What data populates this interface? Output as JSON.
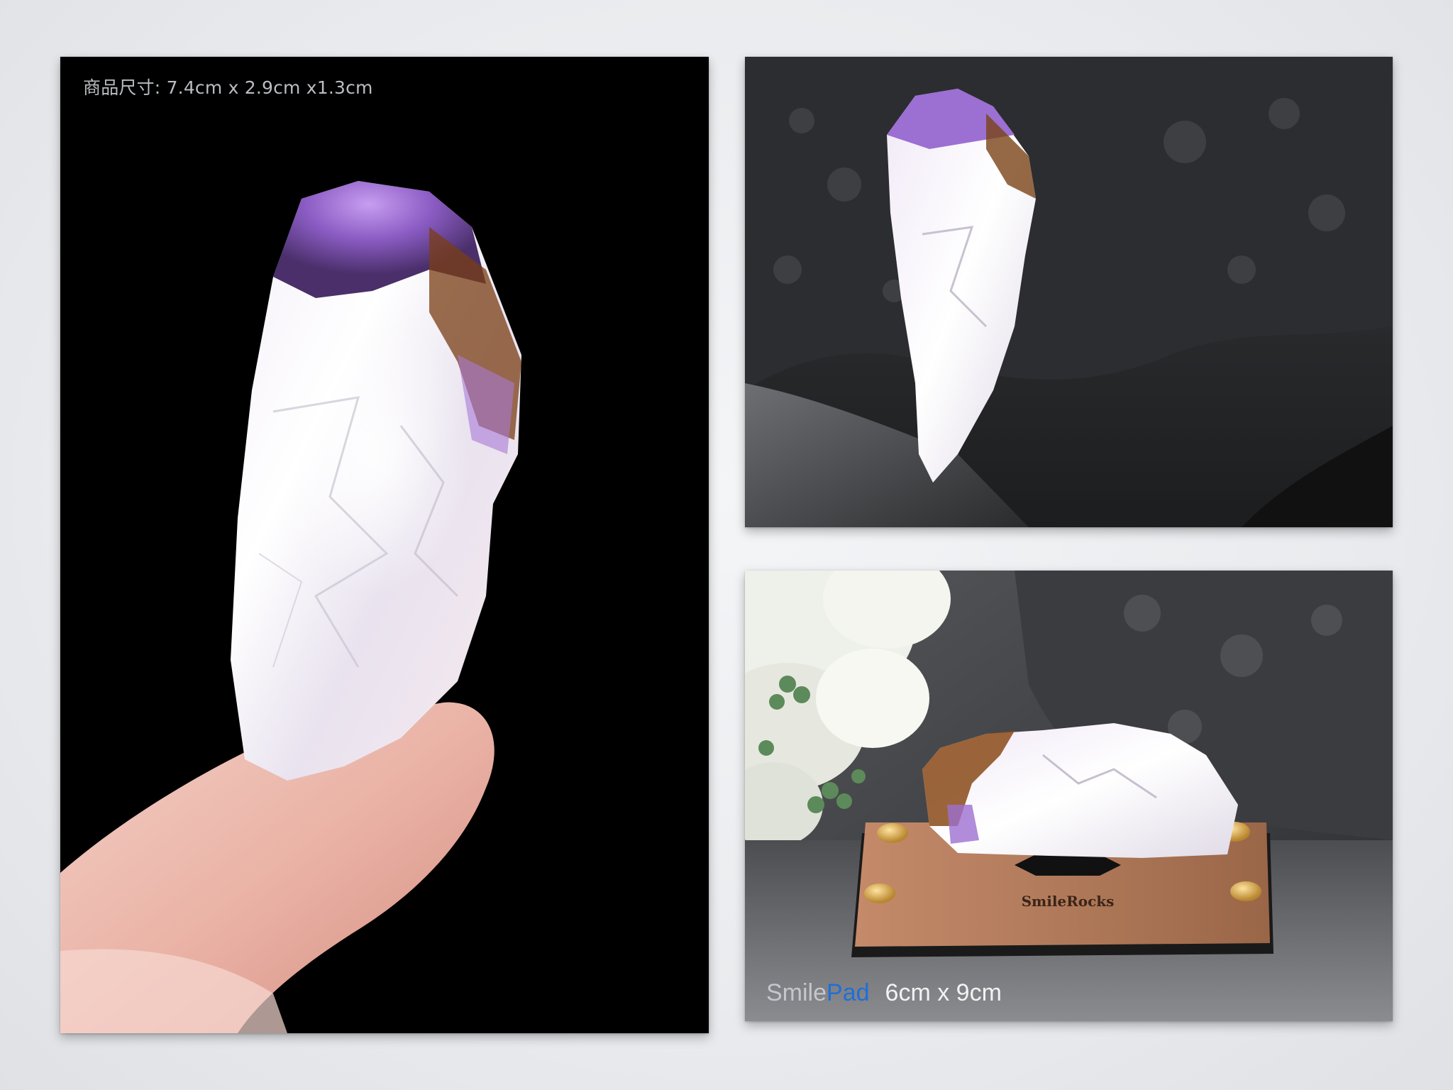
{
  "left_photo": {
    "caption": "商品尺寸: 7.4cm x 2.9cm x1.3cm"
  },
  "bottom_photo": {
    "brand_smile": "Smile",
    "brand_pad": "Pad",
    "dimensions": "6cm x 9cm",
    "engraving": "SmileRocks"
  },
  "colors": {
    "page_background": "#ececef",
    "pad_accent": "#1f6fd6",
    "crystal_purple": "#9b6fd0",
    "crystal_inclusion": "#8a4a18",
    "walnut_base": "#b07a5a",
    "brass": "#d4a548"
  },
  "icons": {
    "crystal": "amethyst-crystal-icon",
    "finger": "finger-icon",
    "rock": "rock-icon",
    "flowers": "flower-icon",
    "stand": "wooden-stand-icon"
  }
}
